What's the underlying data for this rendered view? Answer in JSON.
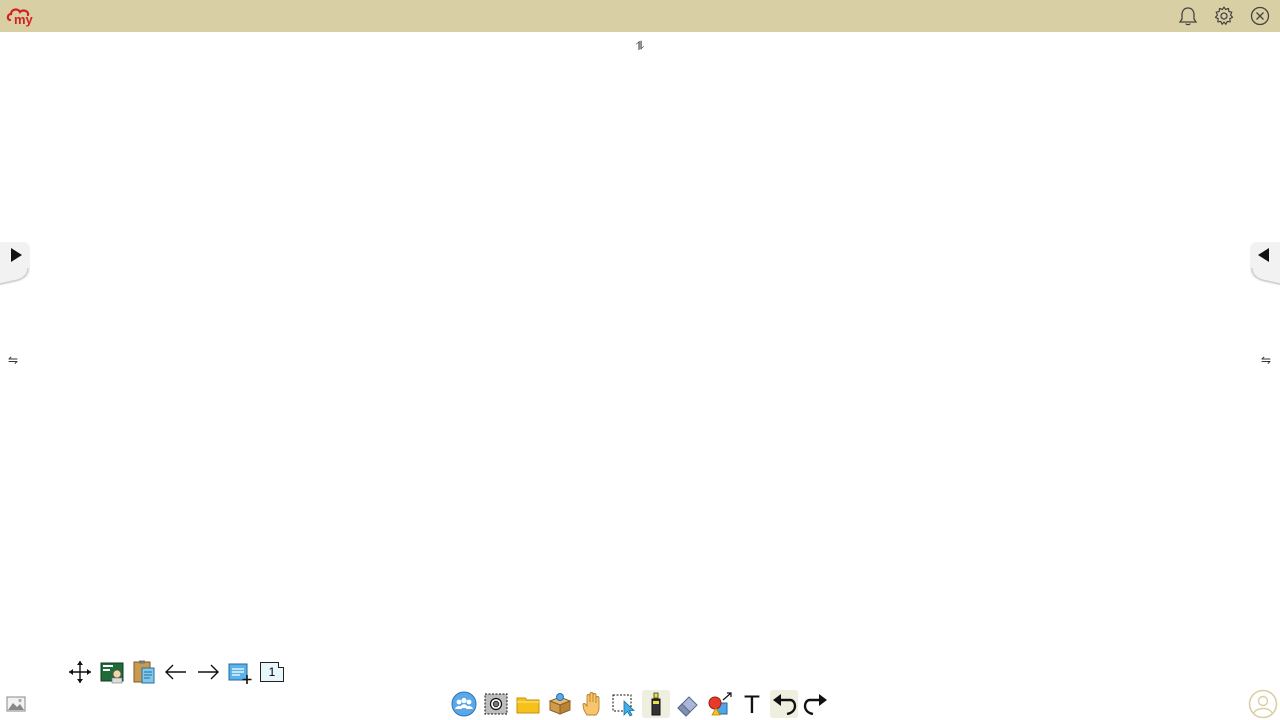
{
  "app": {
    "logo_text": "my",
    "brand_color": "#d42020",
    "topbar_color": "#d9cfa4"
  },
  "top_icons": [
    "bell-icon",
    "gear-icon",
    "close-icon"
  ],
  "canvas": {
    "center_swap_glyph": "⥮",
    "left_swap_glyph": "⇋",
    "right_swap_glyph": "⇋"
  },
  "left_toolbar": {
    "tools": [
      "move-icon",
      "board-icon",
      "clipboard-icon",
      "arrow-left-icon",
      "arrow-right-icon",
      "add-page-icon",
      "page-number-icon"
    ],
    "page_number": "1"
  },
  "main_toolbar": {
    "tools": [
      "people-icon",
      "screenshot-icon",
      "folder-icon",
      "box-icon",
      "hand-icon",
      "select-icon",
      "highlighter-icon",
      "eraser-icon",
      "shapes-icon",
      "text-icon",
      "undo-icon",
      "redo-icon"
    ],
    "text_tool_glyph": "T"
  },
  "corner_icons": [
    "background-image-icon",
    "user-icon"
  ]
}
